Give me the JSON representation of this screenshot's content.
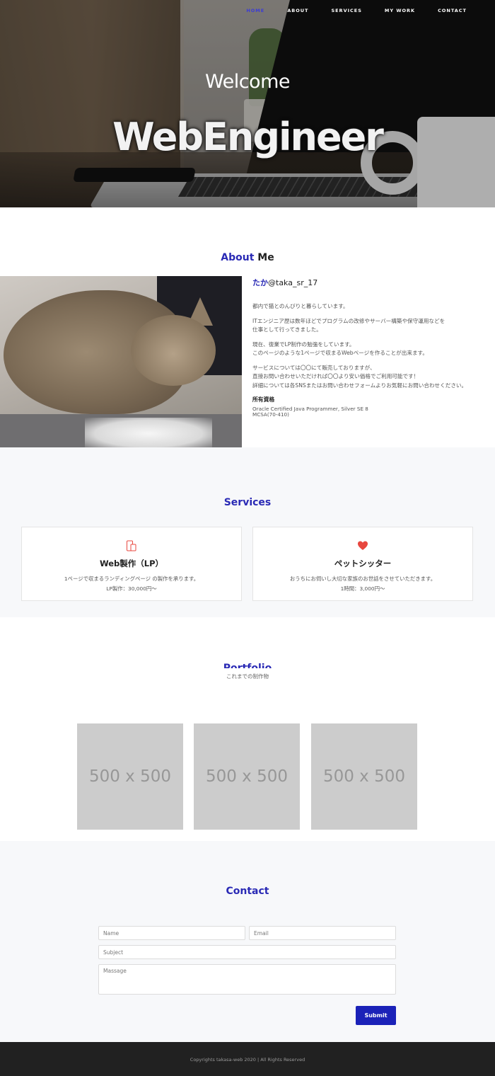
{
  "nav": {
    "items": [
      {
        "label": "HOME"
      },
      {
        "label": "ABOUT"
      },
      {
        "label": "SERVICES"
      },
      {
        "label": "MY WORK"
      },
      {
        "label": "CONTACT"
      }
    ],
    "active_color": "#3b3bd6"
  },
  "hero": {
    "subtitle": "Welcome",
    "title": "WebEngineer"
  },
  "about": {
    "heading_accent": "About",
    "heading_rest": " Me",
    "name_jp": "たか",
    "name_handle": "@taka_sr_17",
    "para1": "都内で猫とのんびりと暮らしています。",
    "para2a": "ITエンジニア歴は数年ほどでプログラムの改修やサーバー構築や保守運用などを",
    "para2b": "仕事として行ってきました。",
    "para3a": "現在、復業でLP制作の勉強をしています。",
    "para3b": "このページのような1ページで収まるWebページを作ることが出来ます。",
    "para4a": "サービスについては〇〇にて販売しておりますが、",
    "para4b": "直接お問い合わせいただければ〇〇より安い価格でご利用可能です！",
    "para4c": "詳細については各SNSまたはお問い合わせフォームよりお気軽にお問い合わせください。",
    "qual_heading": "所有資格",
    "qual1": "Oracle Certified Java Programmer, Silver SE 8",
    "qual2": "MCSA(70-410)"
  },
  "services": {
    "heading": "Services",
    "cards": [
      {
        "icon": "mobile-icon",
        "title": "Web製作（LP）",
        "desc1": "1ページで収まるランディングページ の製作を承ります。",
        "desc2": "LP製作：30,000円〜"
      },
      {
        "icon": "heart-icon",
        "title": "ペットシッター",
        "desc1": "おうちにお伺いし大切な家族のお世話をさせていただきます。",
        "desc2": "1時間：3,000円〜"
      }
    ],
    "accent_color": "#e8473f"
  },
  "portfolio": {
    "heading": "Portfolio",
    "subtitle": "これまでの制作物",
    "tiles": [
      {
        "label": "500 x 500"
      },
      {
        "label": "500 x 500"
      },
      {
        "label": "500 x 500"
      }
    ]
  },
  "contact": {
    "heading": "Contact",
    "name_placeholder": "Name",
    "email_placeholder": "Email",
    "subject_placeholder": "Subject",
    "message_placeholder": "Massage",
    "submit_label": "Submit",
    "button_color": "#1b22b8"
  },
  "footer": {
    "copyright": "Copyrights takasa-web 2020 | All Rights Reserved"
  }
}
